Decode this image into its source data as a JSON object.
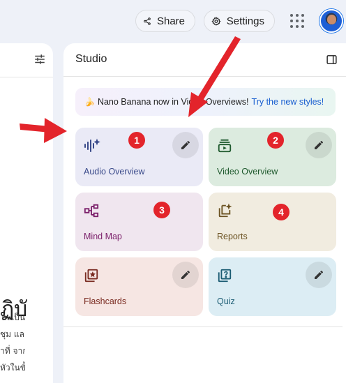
{
  "topbar": {
    "share_label": "Share",
    "settings_label": "Settings"
  },
  "studio": {
    "title": "Studio",
    "banner": {
      "text": "Nano Banana now in Video Overviews!",
      "link": "Try the new styles!"
    },
    "tiles": {
      "audio": "Audio Overview",
      "video": "Video Overview",
      "mind_map": "Mind Map",
      "reports": "Reports",
      "flashcards": "Flashcards",
      "quiz": "Quiz"
    }
  },
  "left_panel": {
    "heading_fragment": "ฏิบัติ",
    "lines": [
      "ละเป็น",
      "ชุม และ",
      "าที่ จาก",
      "หัวในขั้น"
    ]
  },
  "annotations": {
    "badges": [
      "1",
      "2",
      "3",
      "4"
    ]
  },
  "colors": {
    "accent_link": "#1a5fd0",
    "annotation_red": "#e3242b",
    "audio_tile": "#eaeaf6",
    "video_tile": "#dcebdf",
    "mind_map_tile": "#f0e6ef",
    "reports_tile": "#f1ece0",
    "flashcards_tile": "#f6e6e3",
    "quiz_tile": "#dcedf4"
  }
}
